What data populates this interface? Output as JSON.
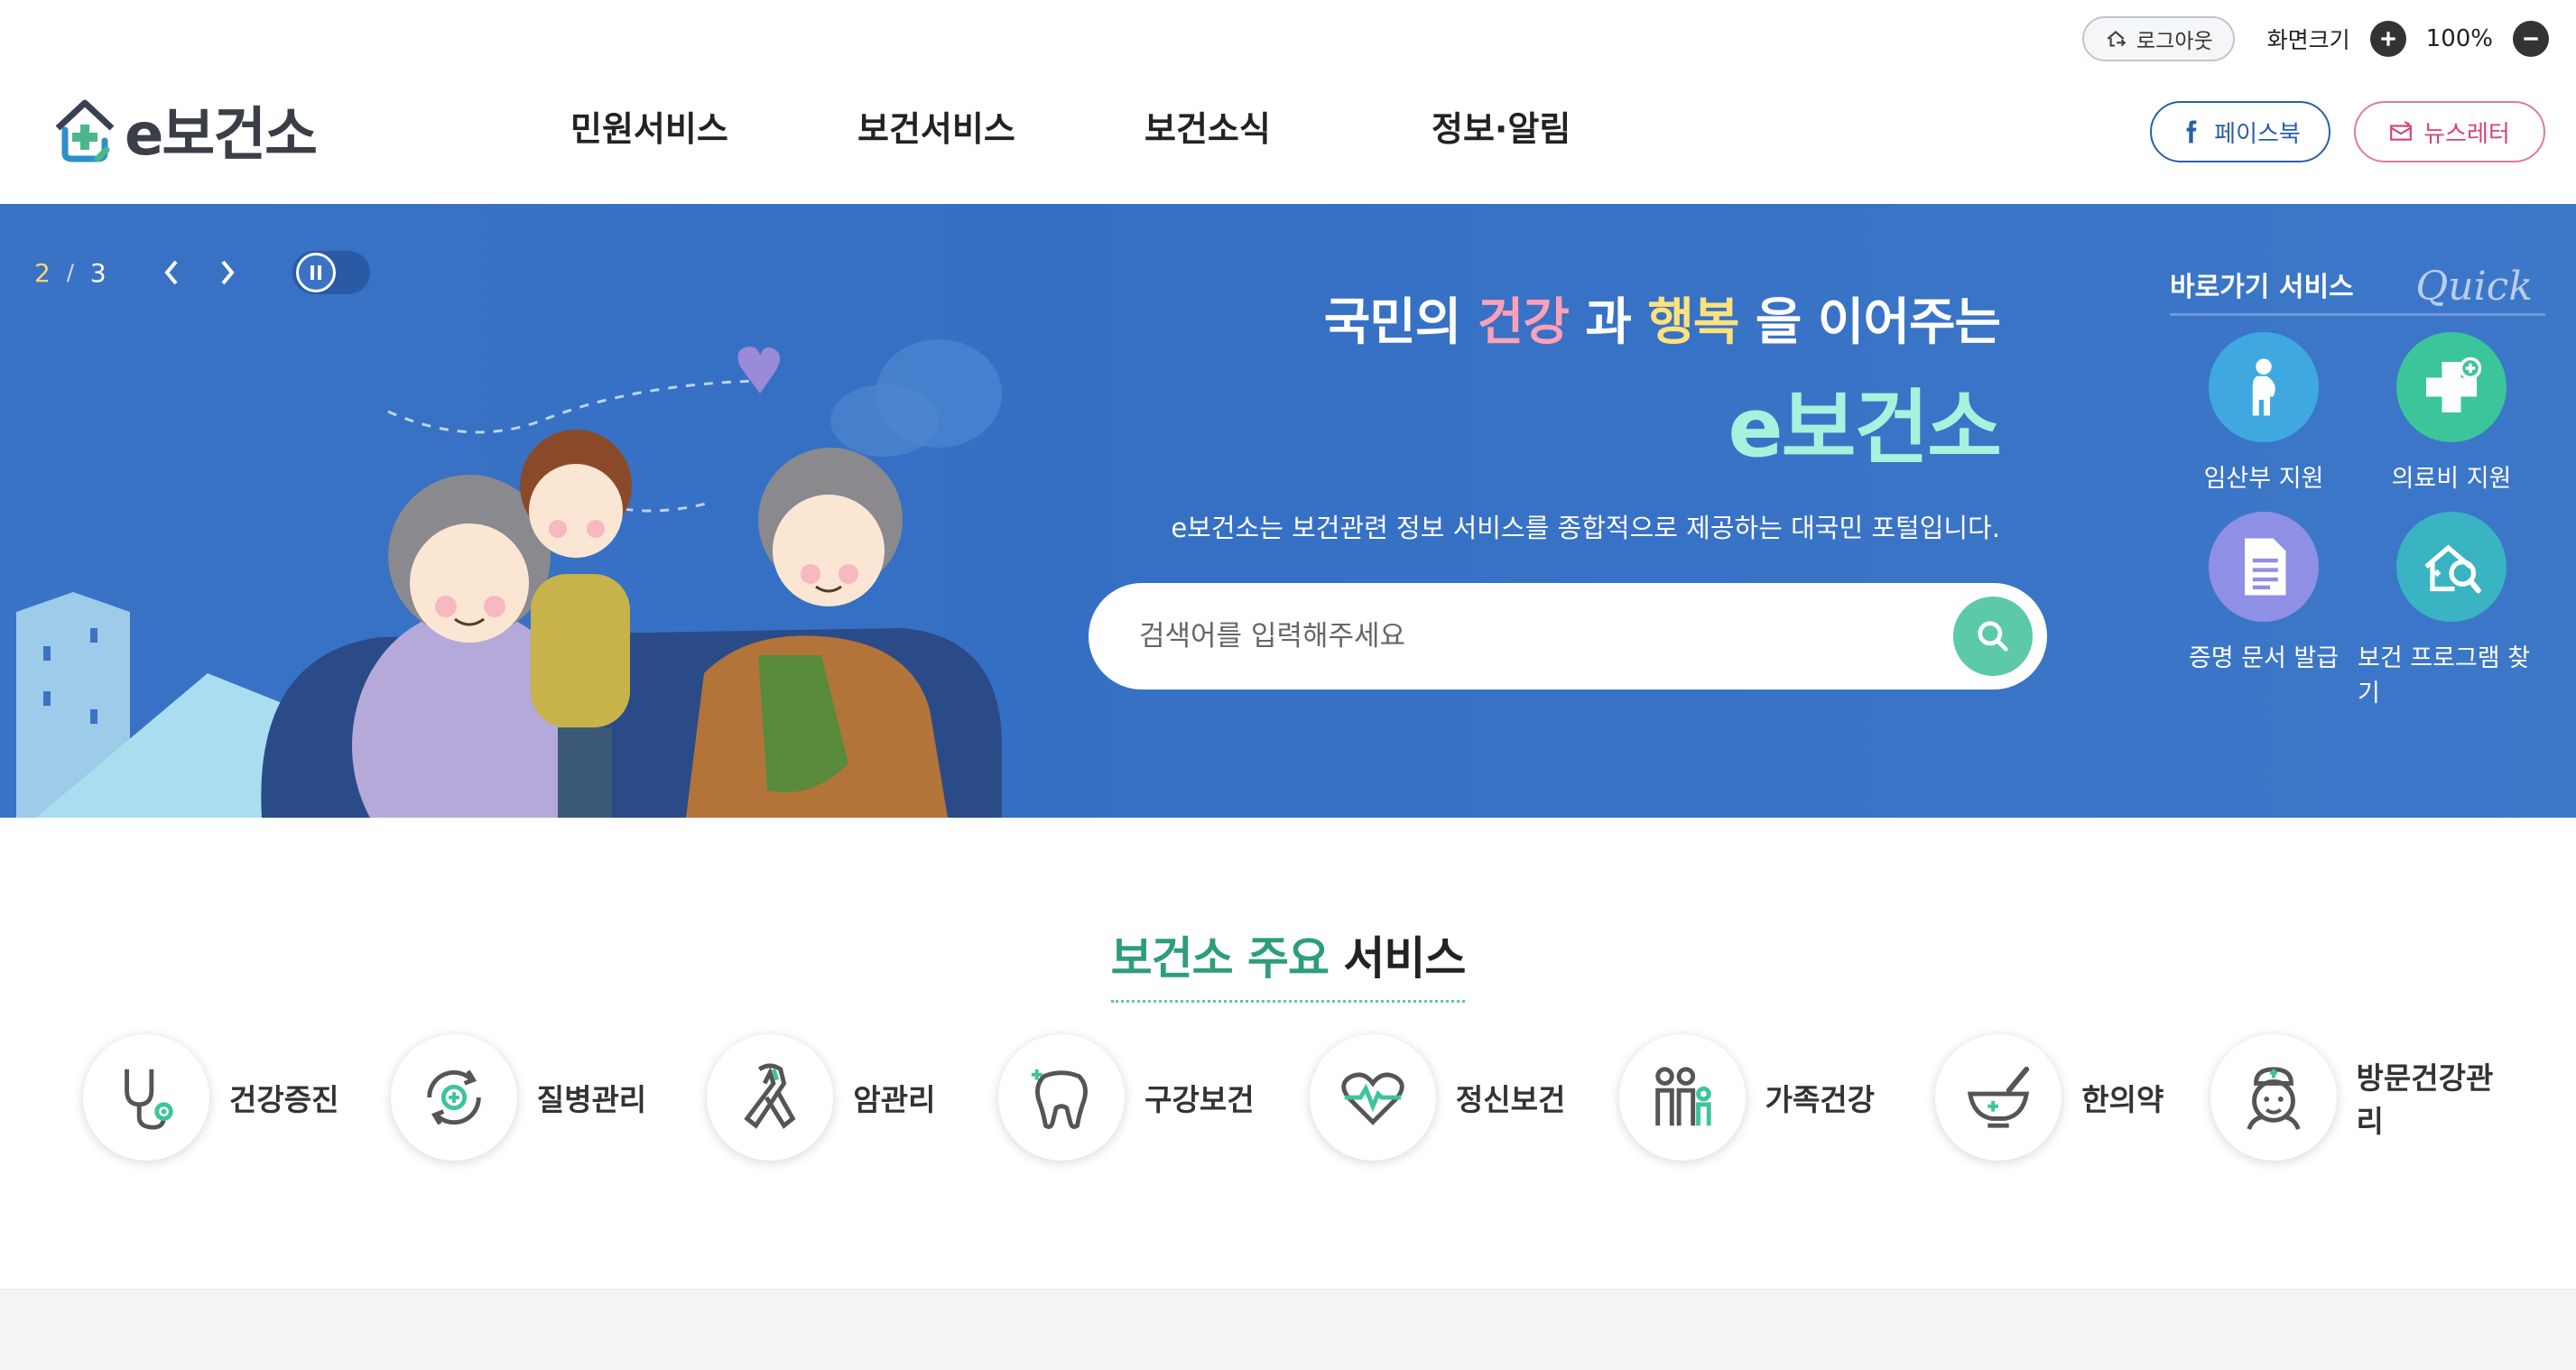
{
  "util": {
    "logout_label": "로그아웃",
    "zoom_label": "화면크기",
    "zoom_value": "100%"
  },
  "header": {
    "logo_text": "e보건소",
    "nav": [
      "민원서비스",
      "보건서비스",
      "보건소식",
      "정보·알림"
    ],
    "facebook_label": "페이스북",
    "newsletter_label": "뉴스레터"
  },
  "visual": {
    "pager_current": "2",
    "pager_separator": "/",
    "pager_total": "3",
    "headline_pre": "국민의 ",
    "headline_word1": "건강",
    "headline_mid": " 과 ",
    "headline_word2": "행복",
    "headline_post": " 을 이어주는",
    "headline_brand": "e보건소",
    "description": "e보건소는 보건관련 정보 서비스를 종합적으로 제공하는 대국민 포털입니다.",
    "search_placeholder": "검색어를 입력해주세요"
  },
  "quick": {
    "title": "바로가기 서비스",
    "script": "Quick",
    "items": [
      {
        "label": "임산부 지원",
        "icon": "pregnant-woman-icon",
        "color": "#3fa8e0"
      },
      {
        "label": "의료비 지원",
        "icon": "medical-cross-icon",
        "color": "#3cc59a"
      },
      {
        "label": "증명 문서 발급",
        "icon": "document-icon",
        "color": "#8f8fe6"
      },
      {
        "label": "보건 프로그램 찾기",
        "icon": "house-search-icon",
        "color": "#3ab3c3"
      }
    ]
  },
  "services": {
    "title_green": "보건소 주요",
    "title_dark": " 서비스",
    "items": [
      {
        "label": "건강증진",
        "icon": "stethoscope-icon"
      },
      {
        "label": "질병관리",
        "icon": "virus-cycle-icon"
      },
      {
        "label": "암관리",
        "icon": "ribbon-icon"
      },
      {
        "label": "구강보건",
        "icon": "tooth-icon"
      },
      {
        "label": "정신보건",
        "icon": "heartbeat-icon"
      },
      {
        "label": "가족건강",
        "icon": "family-icon"
      },
      {
        "label": "한의약",
        "icon": "mortar-icon"
      },
      {
        "label": "방문건강관리",
        "icon": "nurse-icon"
      }
    ]
  },
  "colors": {
    "banner_blue": "#3a73c5",
    "accent_green": "#5cc9a8",
    "brand_dark": "#3a3f47"
  }
}
